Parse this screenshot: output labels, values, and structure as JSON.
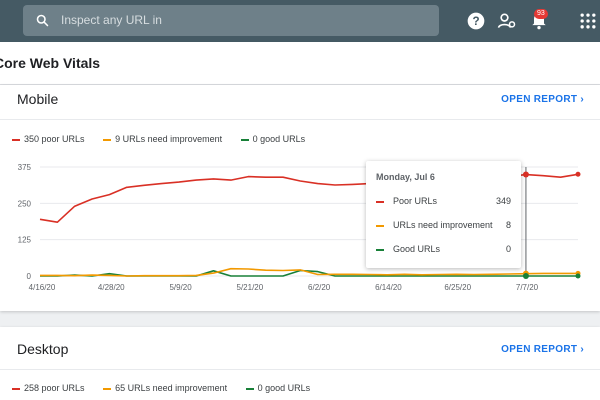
{
  "topbar": {
    "search_placeholder": "Inspect any URL in",
    "notification_count": "93",
    "icons": [
      "search-icon",
      "help-icon",
      "manage-users-icon",
      "notifications-icon",
      "apps-grid-icon"
    ]
  },
  "page": {
    "title": "Core Web Vitals"
  },
  "mobile": {
    "title": "Mobile",
    "open_report": "OPEN REPORT",
    "legend": [
      {
        "label": "350 poor URLs",
        "color": "#d93025"
      },
      {
        "label": "9 URLs need improvement",
        "color": "#f29900"
      },
      {
        "label": "0 good URLs",
        "color": "#188038"
      }
    ],
    "tooltip": {
      "date": "Monday, Jul 6",
      "rows": [
        {
          "label": "Poor URLs",
          "value": "349",
          "color": "#d93025"
        },
        {
          "label": "URLs need improvement",
          "value": "8",
          "color": "#f29900"
        },
        {
          "label": "Good URLs",
          "value": "0",
          "color": "#188038"
        }
      ]
    }
  },
  "desktop": {
    "title": "Desktop",
    "open_report": "OPEN REPORT",
    "legend": [
      {
        "label": "258 poor URLs",
        "color": "#d93025"
      },
      {
        "label": "65 URLs need improvement",
        "color": "#f29900"
      },
      {
        "label": "0 good URLs",
        "color": "#188038"
      }
    ]
  },
  "chart_data": {
    "type": "line",
    "yticks": [
      "375",
      "250",
      "125",
      "0"
    ],
    "xticks": [
      "4/16/20",
      "4/28/20",
      "5/9/20",
      "5/21/20",
      "6/2/20",
      "6/14/20",
      "6/25/20",
      "7/7/20"
    ],
    "ylim": [
      0,
      375
    ],
    "x": [
      "4/16",
      "4/18",
      "4/20",
      "4/22",
      "4/24",
      "4/26",
      "4/28",
      "4/30",
      "5/3",
      "5/6",
      "5/9",
      "5/12",
      "5/15",
      "5/18",
      "5/21",
      "5/24",
      "5/27",
      "5/30",
      "6/2",
      "6/6",
      "6/10",
      "6/14",
      "6/18",
      "6/22",
      "6/25",
      "6/29",
      "7/2",
      "7/4",
      "7/6",
      "7/8",
      "7/10",
      "7/12"
    ],
    "series": [
      {
        "name": "Poor URLs",
        "color": "#d93025",
        "values": [
          195,
          185,
          240,
          265,
          280,
          305,
          312,
          318,
          323,
          330,
          334,
          330,
          342,
          340,
          340,
          327,
          318,
          313,
          315,
          318,
          322,
          322,
          323,
          328,
          330,
          334,
          338,
          342,
          349,
          345,
          340,
          350
        ]
      },
      {
        "name": "URLs need improvement",
        "color": "#f29900",
        "values": [
          2,
          2,
          1,
          3,
          2,
          0,
          1,
          1,
          1,
          2,
          10,
          25,
          24,
          20,
          19,
          21,
          5,
          6,
          6,
          5,
          4,
          6,
          4,
          5,
          6,
          5,
          6,
          7,
          8,
          9,
          9,
          9
        ]
      },
      {
        "name": "Good URLs",
        "color": "#188038",
        "values": [
          0,
          0,
          3,
          0,
          8,
          0,
          0,
          0,
          0,
          0,
          18,
          0,
          0,
          0,
          0,
          19,
          15,
          0,
          0,
          0,
          0,
          0,
          0,
          0,
          0,
          0,
          0,
          0,
          0,
          0,
          0,
          0
        ]
      }
    ],
    "highlight_index": 28,
    "grid": true
  }
}
